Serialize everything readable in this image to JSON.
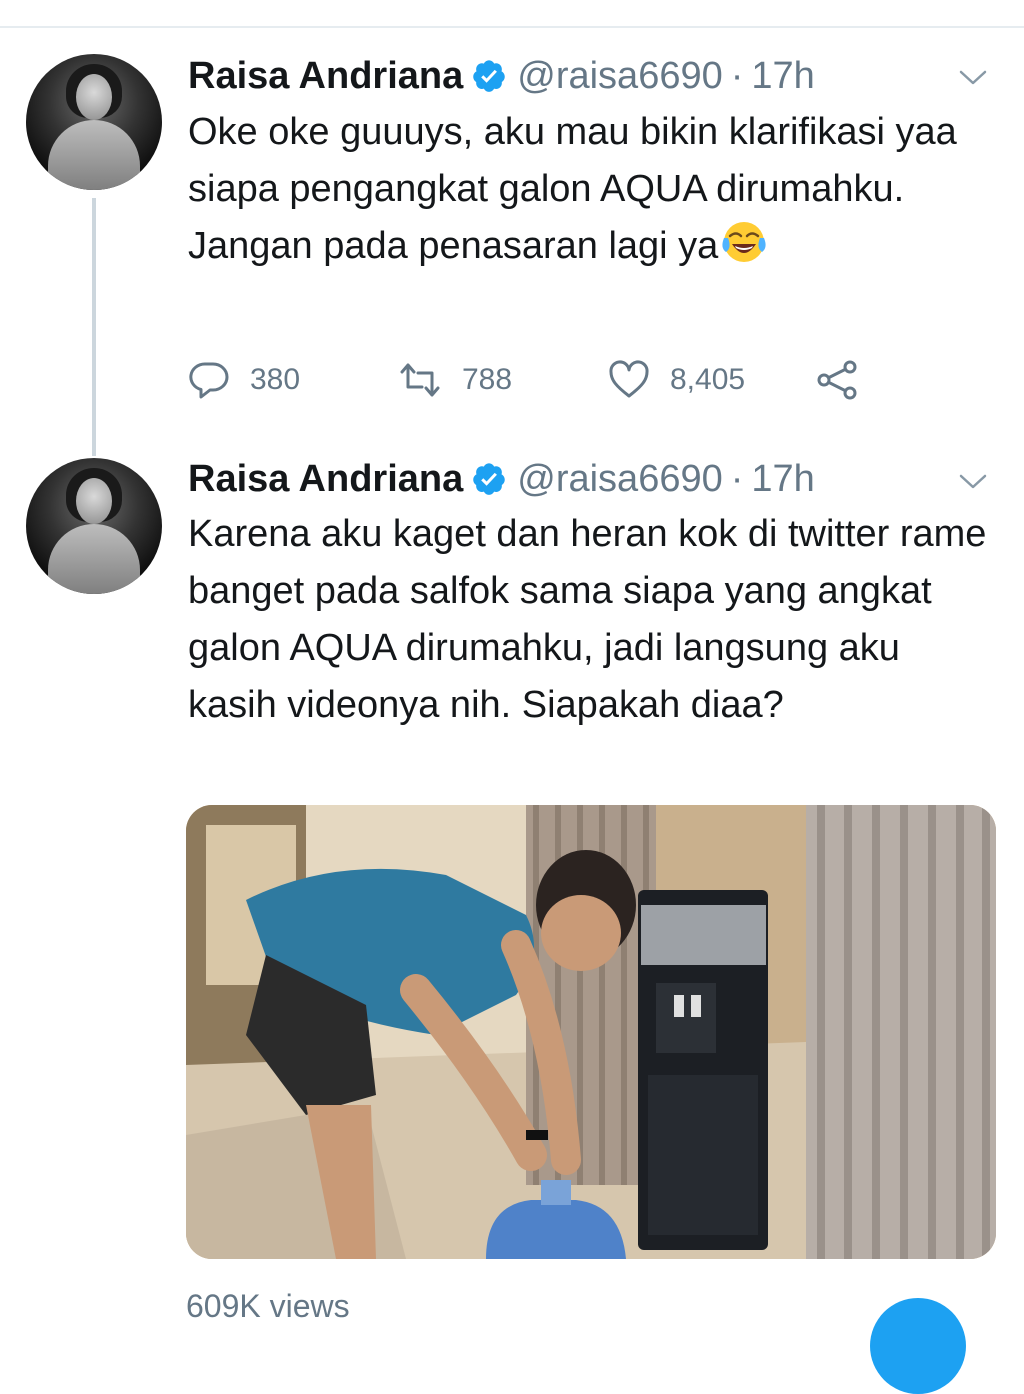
{
  "colors": {
    "accent": "#1da1f2",
    "text_primary": "#14171a",
    "text_secondary": "#657786",
    "divider": "#e6ecf0"
  },
  "tweets": [
    {
      "author": {
        "name": "Raisa Andriana",
        "handle": "@raisa6690",
        "verified": true,
        "avatar": "profile-photo"
      },
      "separator": "·",
      "time": "17h",
      "text": "Oke oke guuuys, aku mau bikin klarifikasi yaa siapa pengangkat galon AQUA dirumahku. Jangan pada penasaran lagi ya",
      "emoji": "face-with-tears-of-joy",
      "actions": {
        "replies": "380",
        "retweets": "788",
        "likes": "8,405"
      },
      "icons": [
        "reply-icon",
        "retweet-icon",
        "like-icon",
        "share-icon",
        "chevron-down-icon"
      ]
    },
    {
      "author": {
        "name": "Raisa Andriana",
        "handle": "@raisa6690",
        "verified": true,
        "avatar": "profile-photo"
      },
      "separator": "·",
      "time": "17h",
      "text": "Karena aku kaget dan heran kok di twitter rame banget pada salfok sama siapa yang angkat galon AQUA dirumahku, jadi langsung aku kasih videonya nih. Siapakah diaa?",
      "media": "video-thumbnail",
      "views": "609K views"
    }
  ]
}
